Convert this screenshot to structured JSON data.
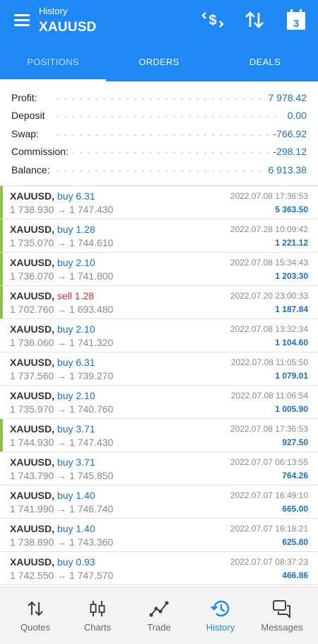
{
  "header": {
    "subtitle": "History",
    "title": "XAUUSD",
    "calendar_day": "3",
    "icons": [
      "menu-icon",
      "currency-exchange-icon",
      "sort-icon",
      "calendar-icon"
    ]
  },
  "tabs": [
    {
      "label": "POSITIONS",
      "active": true
    },
    {
      "label": "ORDERS",
      "active": false
    },
    {
      "label": "DEALS",
      "active": false
    }
  ],
  "summary": [
    {
      "label": "Profit:",
      "value": "7 978.42"
    },
    {
      "label": "Deposit",
      "value": "0.00"
    },
    {
      "label": "Swap:",
      "value": "-766.92"
    },
    {
      "label": "Commission:",
      "value": "-298.12"
    },
    {
      "label": "Balance:",
      "value": "6 913.38"
    }
  ],
  "positions": [
    {
      "symbol": "XAUUSD,",
      "side": "buy 6.31",
      "type": "buy",
      "prices": "1 738.930 → 1 747.430",
      "time": "2022.07.08 17:36:53",
      "profit": "5 363.50",
      "flagged": true
    },
    {
      "symbol": "XAUUSD,",
      "side": "buy 1.28",
      "type": "buy",
      "prices": "1 735.070 → 1 744.610",
      "time": "2022.07.28 10:09:42",
      "profit": "1 221.12",
      "flagged": true
    },
    {
      "symbol": "XAUUSD,",
      "side": "buy 2.10",
      "type": "buy",
      "prices": "1 736.070 → 1 741.800",
      "time": "2022.07.08 15:34:43",
      "profit": "1 203.30",
      "flagged": true
    },
    {
      "symbol": "XAUUSD,",
      "side": "sell 1.28",
      "type": "sell",
      "prices": "1 702.760 → 1 693.480",
      "time": "2022.07.20 23:00:33",
      "profit": "1 187.84",
      "flagged": true
    },
    {
      "symbol": "XAUUSD,",
      "side": "buy 2.10",
      "type": "buy",
      "prices": "1 736.060 → 1 741.320",
      "time": "2022.07.08 13:32:34",
      "profit": "1 104.60",
      "flagged": false
    },
    {
      "symbol": "XAUUSD,",
      "side": "buy 6.31",
      "type": "buy",
      "prices": "1 737.560 → 1 739.270",
      "time": "2022.07.08 11:05:50",
      "profit": "1 079.01",
      "flagged": false
    },
    {
      "symbol": "XAUUSD,",
      "side": "buy 2.10",
      "type": "buy",
      "prices": "1 735.970 → 1 740.760",
      "time": "2022.07.08 11:06:54",
      "profit": "1 005.90",
      "flagged": false
    },
    {
      "symbol": "XAUUSD,",
      "side": "buy 3.71",
      "type": "buy",
      "prices": "1 744.930 → 1 747.430",
      "time": "2022.07.08 17:36:53",
      "profit": "927.50",
      "flagged": true
    },
    {
      "symbol": "XAUUSD,",
      "side": "buy 3.71",
      "type": "buy",
      "prices": "1 743.790 → 1 745.850",
      "time": "2022.07.07 06:13:55",
      "profit": "764.26",
      "flagged": false
    },
    {
      "symbol": "XAUUSD,",
      "side": "buy 1.40",
      "type": "buy",
      "prices": "1 741.990 → 1 746.740",
      "time": "2022.07.07 16:49:10",
      "profit": "665.00",
      "flagged": false
    },
    {
      "symbol": "XAUUSD,",
      "side": "buy 1.40",
      "type": "buy",
      "prices": "1 738.890 → 1 743.360",
      "time": "2022.07.07 16:18:21",
      "profit": "625.80",
      "flagged": false
    },
    {
      "symbol": "XAUUSD,",
      "side": "buy 0.93",
      "type": "buy",
      "prices": "1 742.550 → 1 747.570",
      "time": "2022.07.07 08:37:23",
      "profit": "466.86",
      "flagged": false
    }
  ],
  "bottom_nav": [
    {
      "label": "Quotes",
      "icon": "quotes-icon",
      "active": false
    },
    {
      "label": "Charts",
      "icon": "charts-icon",
      "active": false
    },
    {
      "label": "Trade",
      "icon": "trade-icon",
      "active": false
    },
    {
      "label": "History",
      "icon": "history-icon",
      "active": true
    },
    {
      "label": "Messages",
      "icon": "messages-icon",
      "active": false
    }
  ],
  "colors": {
    "accent": "#1e88f5",
    "profit_blue": "#1a6dc8",
    "sell_red": "#d32f2f",
    "flag_green": "#8bc34a"
  }
}
